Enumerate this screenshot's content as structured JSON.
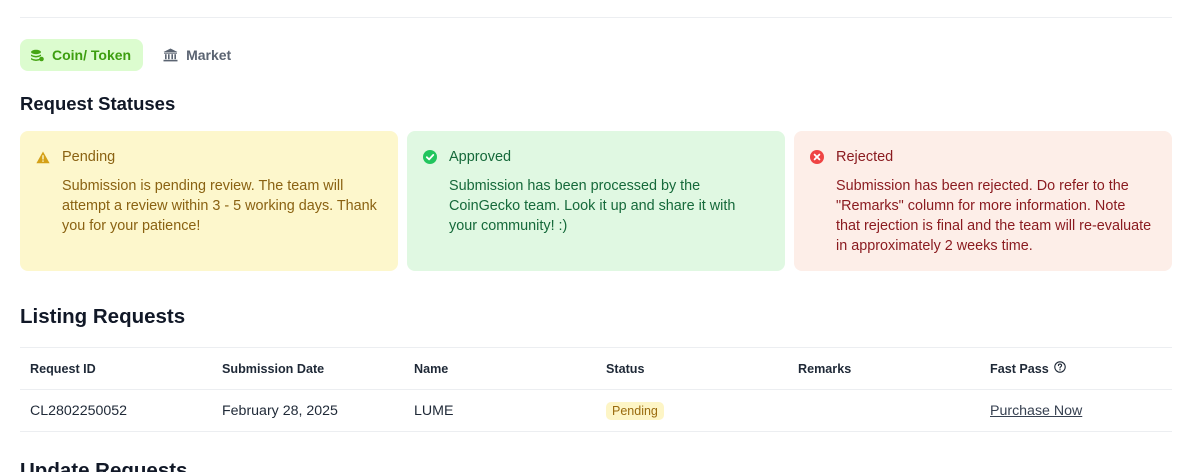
{
  "tabs": [
    {
      "label": "Coin/ Token",
      "icon": "coins-icon",
      "active": true
    },
    {
      "label": "Market",
      "icon": "bank-icon",
      "active": false
    }
  ],
  "request_statuses": {
    "heading": "Request Statuses",
    "cards": [
      {
        "title": "Pending",
        "icon": "warning-icon",
        "text": "Submission is pending review. The team will attempt a review within 3 - 5 working days. Thank you for your patience!"
      },
      {
        "title": "Approved",
        "icon": "check-circle-icon",
        "text": "Submission has been processed by the CoinGecko team. Look it up and share it with your community! :)"
      },
      {
        "title": "Rejected",
        "icon": "x-circle-icon",
        "text": "Submission has been rejected. Do refer to the \"Remarks\" column for more information. Note that rejection is final and the team will re-evaluate in approximately 2 weeks time."
      }
    ]
  },
  "listing_requests": {
    "heading": "Listing Requests",
    "columns": [
      "Request ID",
      "Submission Date",
      "Name",
      "Status",
      "Remarks",
      "Fast Pass"
    ],
    "rows": [
      {
        "request_id": "CL2802250052",
        "submission_date": "February 28, 2025",
        "name": "LUME",
        "status": "Pending",
        "remarks": "",
        "fast_pass": "Purchase Now"
      }
    ]
  },
  "update_requests": {
    "heading": "Update Requests"
  },
  "colors": {
    "active_tab_bg": "#dcfccf",
    "pending_bg": "#fdf7cc",
    "approved_bg": "#e0f8e2",
    "rejected_bg": "#fdeee8"
  }
}
